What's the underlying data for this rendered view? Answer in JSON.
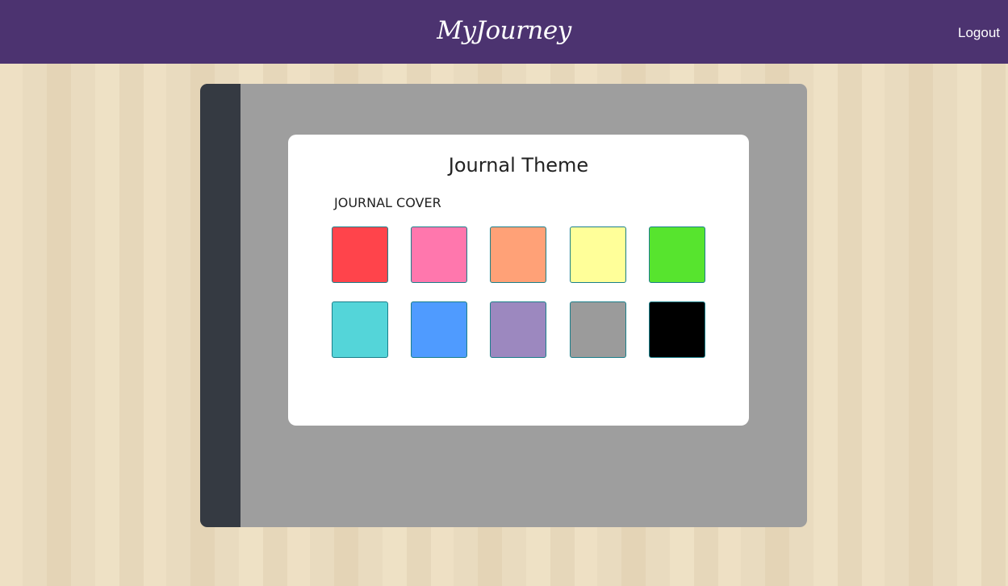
{
  "header": {
    "brand": "MyJourney",
    "logout_label": "Logout",
    "background_color": "#4c3370"
  },
  "journal": {
    "cover_color": "#9e9e9e",
    "spine_color": "#353a42"
  },
  "theme_panel": {
    "title": "Journal Theme",
    "cover_label": "JOURNAL COVER",
    "swatches": [
      {
        "name": "red",
        "color": "#ff444b"
      },
      {
        "name": "pink",
        "color": "#ff77ad"
      },
      {
        "name": "orange",
        "color": "#ffa177"
      },
      {
        "name": "yellow",
        "color": "#ffff99"
      },
      {
        "name": "green",
        "color": "#57e42e"
      },
      {
        "name": "teal",
        "color": "#54d5d9"
      },
      {
        "name": "blue",
        "color": "#4f9bff"
      },
      {
        "name": "purple",
        "color": "#9c88bf"
      },
      {
        "name": "gray",
        "color": "#9b9b9b"
      },
      {
        "name": "black",
        "color": "#000000"
      }
    ]
  }
}
